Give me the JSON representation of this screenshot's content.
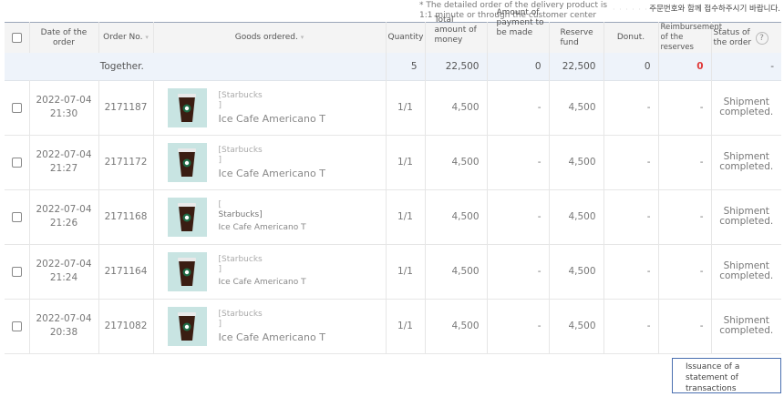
{
  "notice": {
    "english": "* The detailed order of the delivery product is 1:1 minute or through the customer center",
    "korean": "주문번호와 함께 접수하주시기 바랍니다."
  },
  "headers": {
    "date": "Date of the order",
    "order_no": "Order No.",
    "goods": "Goods ordered.",
    "quantity": "Quantity",
    "total": "Total amount of money",
    "payment": "Amount of payment to be made",
    "reserve": "Reserve fund",
    "donut": "Donut.",
    "reimbursement": "Reimbursement of the reserves",
    "status": "Status of the order",
    "help": "?"
  },
  "summary": {
    "label": "Together.",
    "quantity": "5",
    "total": "22,500",
    "payment": "0",
    "reserve": "22,500",
    "donut": "0",
    "reimbursement": "0",
    "status": "-"
  },
  "orders": [
    {
      "date": "2022-07-04",
      "time": "21:30",
      "order_no": "2171187",
      "brand": "[Starbucks",
      "bracket": "]",
      "name": "Ice Cafe Americano T",
      "quantity": "1/1",
      "total": "4,500",
      "payment": "-",
      "reserve": "4,500",
      "donut": "-",
      "reimbursement": "-",
      "status": "Shipment completed."
    },
    {
      "date": "2022-07-04",
      "time": "21:27",
      "order_no": "2171172",
      "brand": "[Starbucks",
      "bracket": "]",
      "name": "Ice Cafe Americano T",
      "quantity": "1/1",
      "total": "4,500",
      "payment": "-",
      "reserve": "4,500",
      "donut": "-",
      "reimbursement": "-",
      "status": "Shipment completed."
    },
    {
      "date": "2022-07-04",
      "time": "21:26",
      "order_no": "2171168",
      "brand": "[",
      "bracket": "Starbucks]",
      "name": "Ice Cafe Americano T",
      "quantity": "1/1",
      "total": "4,500",
      "payment": "-",
      "reserve": "4,500",
      "donut": "-",
      "reimbursement": "-",
      "status": "Shipment completed."
    },
    {
      "date": "2022-07-04",
      "time": "21:24",
      "order_no": "2171164",
      "brand": "[Starbucks",
      "bracket": "]",
      "name": "Ice Cafe Americano T",
      "quantity": "1/1",
      "total": "4,500",
      "payment": "-",
      "reserve": "4,500",
      "donut": "-",
      "reimbursement": "-",
      "status": "Shipment completed."
    },
    {
      "date": "2022-07-04",
      "time": "20:38",
      "order_no": "2171082",
      "brand": "[Starbucks",
      "bracket": "]",
      "name": "Ice Cafe Americano T",
      "quantity": "1/1",
      "total": "4,500",
      "payment": "-",
      "reserve": "4,500",
      "donut": "-",
      "reimbursement": "-",
      "status": "Shipment completed."
    }
  ],
  "issue_button": "Issuance of a statement of transactions",
  "colors": {
    "header_border": "#9aa6b8",
    "summary_bg": "#eef3fa",
    "thumb_bg": "#c8e4e2",
    "reimburse_red": "#e03a3a",
    "button_border": "#4a6fb0"
  },
  "icons": {
    "product_thumbnail": "starbucks-cup-icon",
    "help": "question-circle-icon"
  }
}
